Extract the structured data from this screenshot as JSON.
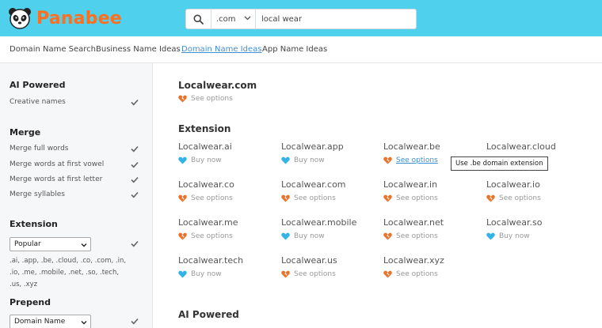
{
  "brand": {
    "name": "Panabee",
    "logo_icon": "panda-logo-icon",
    "accent": "#ff6f1f",
    "header_bg": "#4fd0ec"
  },
  "search": {
    "tld": ".com",
    "query": "local wear"
  },
  "nav": [
    "Domain Name Search",
    "Business Name Ideas",
    "Domain Name Ideas",
    "App Name Ideas"
  ],
  "nav_active": "Domain Name Ideas",
  "sidebar": {
    "ai_title": "AI Powered",
    "ai_items": [
      "Creative names"
    ],
    "merge_title": "Merge",
    "merge_items": [
      "Merge full words",
      "Merge words at first vowel",
      "Merge words at first letter",
      "Merge syllables"
    ],
    "extension_title": "Extension",
    "extension_select": "Popular",
    "extension_note": ".ai, .app, .be, .cloud, .co, .com, .in, .io, .me, .mobile, .net, .so, .tech, .us, .xyz",
    "prepend_title": "Prepend",
    "prepend_select": "Domain Name"
  },
  "main": {
    "top_domain": {
      "name": "Localwear.com",
      "status": "See options"
    },
    "extension_title": "Extension",
    "ai_title": "AI Powered",
    "tooltip": "Use .be domain extension",
    "domains": [
      {
        "name": "Localwear.ai",
        "status": "Buy now"
      },
      {
        "name": "Localwear.app",
        "status": "Buy now"
      },
      {
        "name": "Localwear.be",
        "status": "See options"
      },
      {
        "name": "Localwear.cloud",
        "status": ""
      },
      {
        "name": "Localwear.co",
        "status": "See options"
      },
      {
        "name": "Localwear.com",
        "status": "See options"
      },
      {
        "name": "Localwear.in",
        "status": "See options"
      },
      {
        "name": "Localwear.io",
        "status": "See options"
      },
      {
        "name": "Localwear.me",
        "status": "See options"
      },
      {
        "name": "Localwear.mobile",
        "status": "Buy now"
      },
      {
        "name": "Localwear.net",
        "status": "See options"
      },
      {
        "name": "Localwear.so",
        "status": "Buy now"
      },
      {
        "name": "Localwear.tech",
        "status": "Buy now"
      },
      {
        "name": "Localwear.us",
        "status": "See options"
      },
      {
        "name": "Localwear.xyz",
        "status": "See options"
      }
    ]
  },
  "icons": {
    "available": "blue-heart-icon",
    "taken": "broken-heart-icon",
    "check": "check-icon",
    "search": "search-icon"
  },
  "colors": {
    "available_heart": "#35b3e6",
    "taken_heart": "#e8732b",
    "link": "#3f8fd2"
  }
}
